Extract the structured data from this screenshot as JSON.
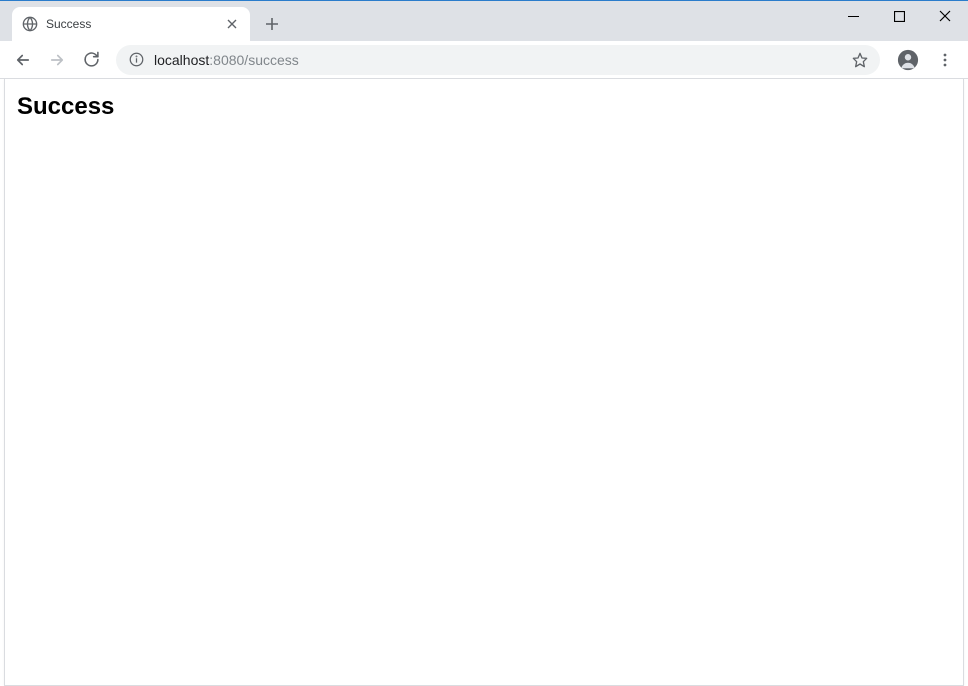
{
  "tab": {
    "title": "Success"
  },
  "address": {
    "host": "localhost",
    "port_and_path": ":8080/success"
  },
  "page": {
    "heading": "Success"
  }
}
